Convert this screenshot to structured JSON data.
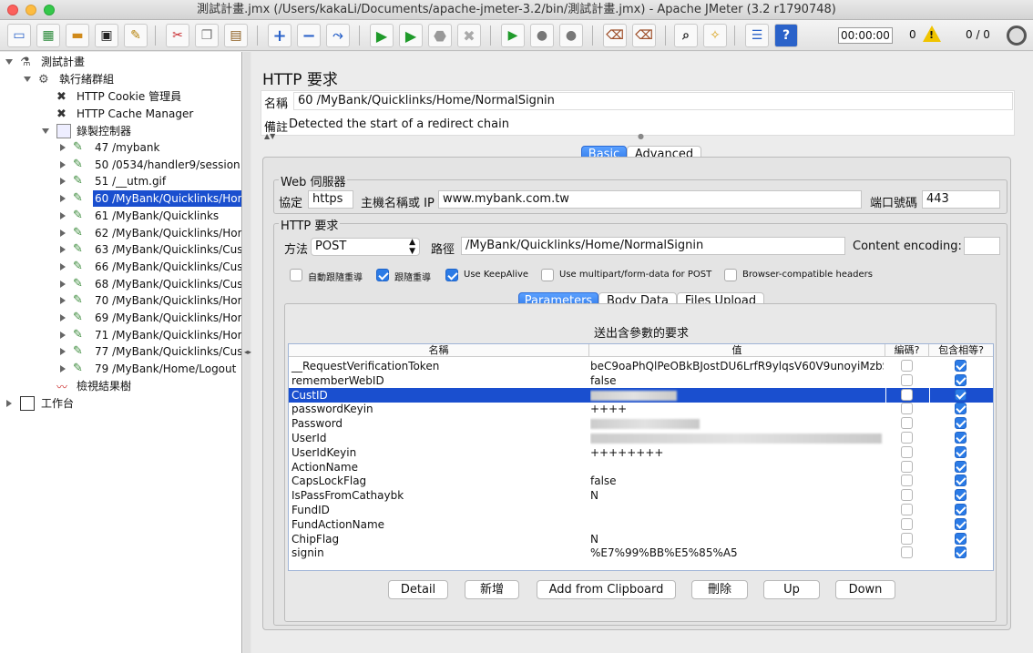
{
  "window": {
    "title": "測試計畫.jmx (/Users/kakaLi/Documents/apache-jmeter-3.2/bin/測試計畫.jmx) - Apache JMeter (3.2 r1790748)"
  },
  "toolbar": {
    "timer": "00:00:00",
    "errors": "0",
    "threads": "0 / 0"
  },
  "tree": {
    "root": "測試計畫",
    "thread_group": "執行緒群組",
    "cookie": "HTTP Cookie 管理員",
    "cache": "HTTP Cache Manager",
    "recorder": "錄製控制器",
    "samplers": [
      "47 /mybank",
      "50 /0534/handler9/session",
      "51 /__utm.gif",
      "60 /MyBank/Quicklinks/Hom",
      "61 /MyBank/Quicklinks",
      "62 /MyBank/Quicklinks/Hom",
      "63 /MyBank/Quicklinks/Cust",
      "66 /MyBank/Quicklinks/Cust",
      "68 /MyBank/Quicklinks/Cust",
      "70 /MyBank/Quicklinks/Hom",
      "69 /MyBank/Quicklinks/Hom",
      "71 /MyBank/Quicklinks/Hom",
      "77 /MyBank/Quicklinks/Cust",
      "79 /MyBank/Home/Logout"
    ],
    "results": "檢視結果樹",
    "workbench": "工作台"
  },
  "panel": {
    "title": "HTTP 要求",
    "name_label": "名稱",
    "name_value": "60 /MyBank/Quicklinks/Home/NormalSignin",
    "comment_label": "備註",
    "comment_value": "Detected the start of a redirect chain",
    "tab_basic": "Basic",
    "tab_advanced": "Advanced",
    "web_server": "Web 伺服器",
    "protocol_label": "協定",
    "protocol_value": "https",
    "host_label": "主機名稱或 IP",
    "host_value": "www.mybank.com.tw",
    "port_label": "端口號碼",
    "port_value": "443",
    "http_request": "HTTP 要求",
    "method_label": "方法",
    "method_value": "POST",
    "path_label": "路徑",
    "path_value": "/MyBank/Quicklinks/Home/NormalSignin",
    "encoding_label": "Content encoding:",
    "encoding_value": "",
    "cb_auto_redirect": "自動跟隨重導",
    "cb_follow_redirect": "跟隨重導",
    "cb_keepalive": "Use KeepAlive",
    "cb_multipart": "Use multipart/form-data for POST",
    "cb_browser": "Browser-compatible headers",
    "tab_params": "Parameters",
    "tab_body": "Body Data",
    "tab_files": "Files Upload",
    "params_title": "送出含參數的要求",
    "col_name": "名稱",
    "col_value": "值",
    "col_encode": "編碼?",
    "col_include": "包含相等?"
  },
  "params": [
    {
      "name": "__RequestVerificationToken",
      "value": "beC9oaPhQlPeOBkBJostDU6LrfR9ylqsV60V9unoyiMzbS..."
    },
    {
      "name": "rememberWebID",
      "value": "false"
    },
    {
      "name": "CustID",
      "value": ""
    },
    {
      "name": "passwordKeyin",
      "value": "++++"
    },
    {
      "name": "Password",
      "value": ""
    },
    {
      "name": "UserId",
      "value": ""
    },
    {
      "name": "UserIdKeyin",
      "value": "++++++++"
    },
    {
      "name": "ActionName",
      "value": ""
    },
    {
      "name": "CapsLockFlag",
      "value": "false"
    },
    {
      "name": "IsPassFromCathaybk",
      "value": "N"
    },
    {
      "name": "FundID",
      "value": ""
    },
    {
      "name": "FundActionName",
      "value": ""
    },
    {
      "name": "ChipFlag",
      "value": "N"
    },
    {
      "name": "signin",
      "value": "%E7%99%BB%E5%85%A5"
    }
  ],
  "buttons": {
    "detail": "Detail",
    "add": "新增",
    "clipboard": "Add from Clipboard",
    "delete": "刪除",
    "up": "Up",
    "down": "Down"
  }
}
